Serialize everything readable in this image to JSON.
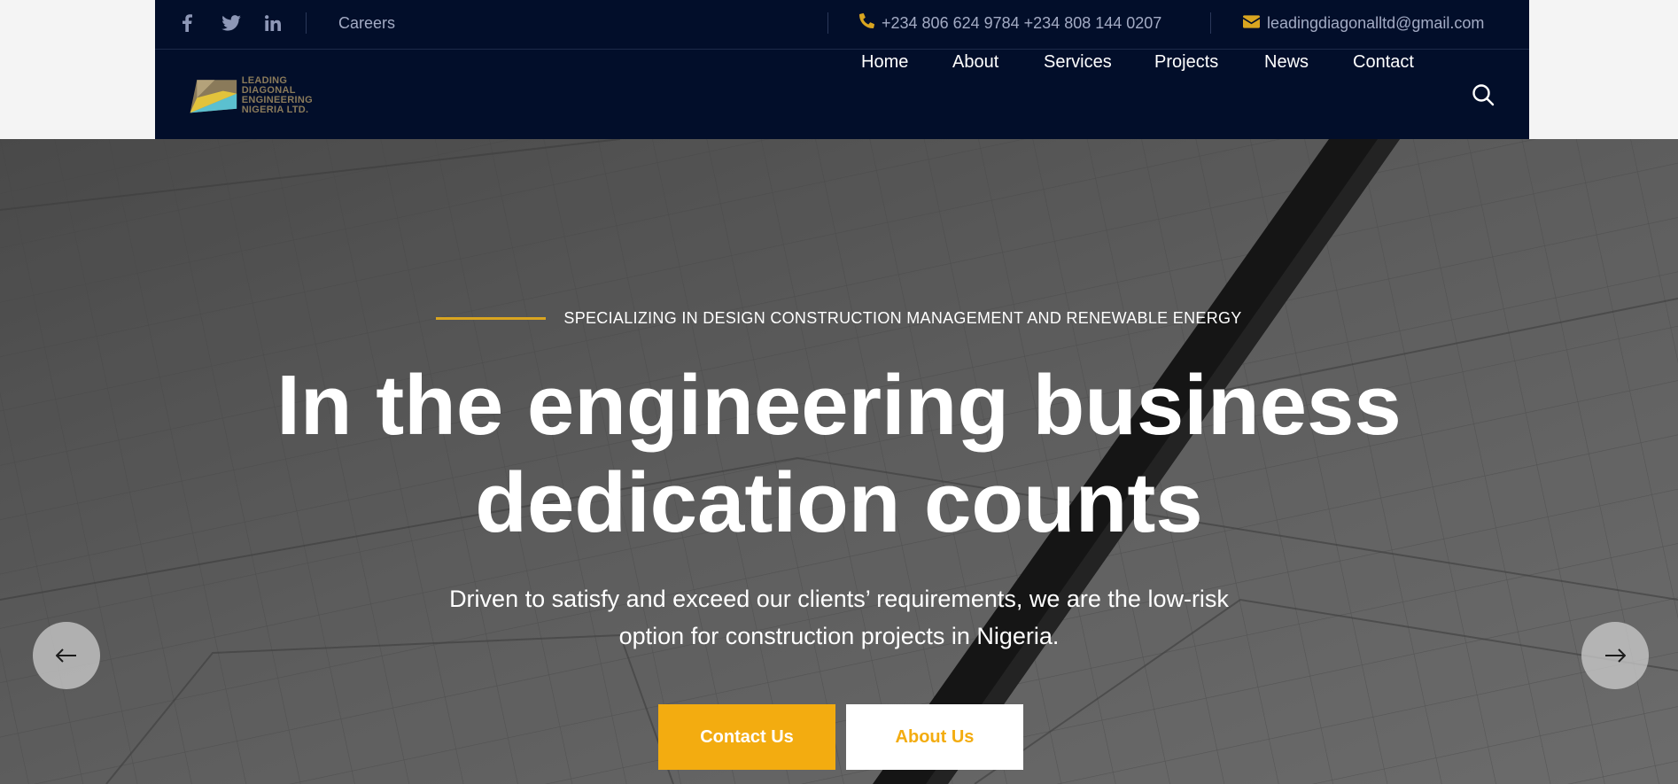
{
  "topbar": {
    "careers_label": "Careers",
    "phone": "+234 806 624 9784 +234 808 144 0207",
    "email": "leadingdiagonalltd@gmail.com"
  },
  "logo": {
    "lines": [
      "LEADING",
      "DIAGONAL",
      "ENGINEERING",
      "NIGERIA LTD."
    ]
  },
  "nav": {
    "items": [
      "Home",
      "About",
      "Services",
      "Projects",
      "News",
      "Contact"
    ]
  },
  "hero": {
    "eyebrow": "SPECIALIZING IN DESIGN CONSTRUCTION MANAGEMENT AND RENEWABLE ENERGY",
    "headline_line1": "In the engineering business",
    "headline_line2": "dedication counts",
    "subtitle_line1": "Driven to satisfy and exceed our clients’ requirements, we are the low-risk",
    "subtitle_line2": "option for construction projects in Nigeria.",
    "primary_button": "Contact Us",
    "secondary_button": "About Us"
  },
  "colors": {
    "navy": "#020e2a",
    "accent": "#f3ac10",
    "gold_line": "#d9a520"
  },
  "icons": [
    "facebook-icon",
    "twitter-icon",
    "linkedin-icon",
    "phone-icon",
    "envelope-icon",
    "search-icon",
    "arrow-left-icon",
    "arrow-right-icon"
  ]
}
